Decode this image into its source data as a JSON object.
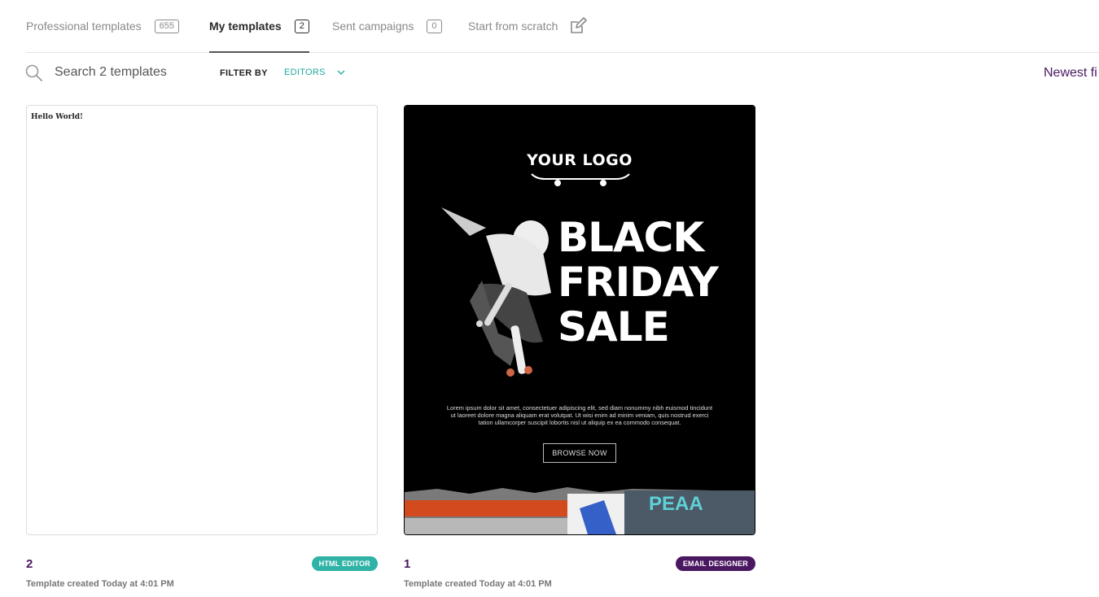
{
  "tabs": [
    {
      "label": "Professional templates",
      "count": "655"
    },
    {
      "label": "My templates",
      "count": "2",
      "active": true
    },
    {
      "label": "Sent campaigns",
      "count": "0"
    },
    {
      "label": "Start from scratch",
      "icon": "edit-icon"
    }
  ],
  "toolbar": {
    "search_placeholder": "Search 2 templates",
    "filter_label": "FILTER BY",
    "filter_value": "EDITORS",
    "sort_label": "Newest fi"
  },
  "templates": [
    {
      "name": "2",
      "preview_text": "Hello World!",
      "badge": "HTML EDITOR",
      "badge_color": "#2fb3a6",
      "meta": "Template created Today at 4:01 PM"
    },
    {
      "name": "1",
      "badge": "EMAIL DESIGNER",
      "badge_color": "#4a1761",
      "meta": "Template created Today at 4:01 PM",
      "preview": {
        "logo": "YOUR LOGO",
        "headline_1": "BLACK",
        "headline_2": "FRIDAY",
        "headline_3": "SALE",
        "body": "Lorem ipsum dolor sit amet, consectetuer adipiscing elit, sed diam nonummy nibh euismod tincidunt ut laoreet dolore magna aliquam erat volutpat. Ut wisi enim ad minim veniam, quis nostrud exerci tation ullamcorper suscipit lobortis nisl ut aliquip ex ea commodo consequat.",
        "cta": "BROWSE NOW",
        "graffiti": "PEAA"
      }
    }
  ],
  "colors": {
    "accent_teal": "#20a89d",
    "brand_purple": "#4a1761"
  }
}
